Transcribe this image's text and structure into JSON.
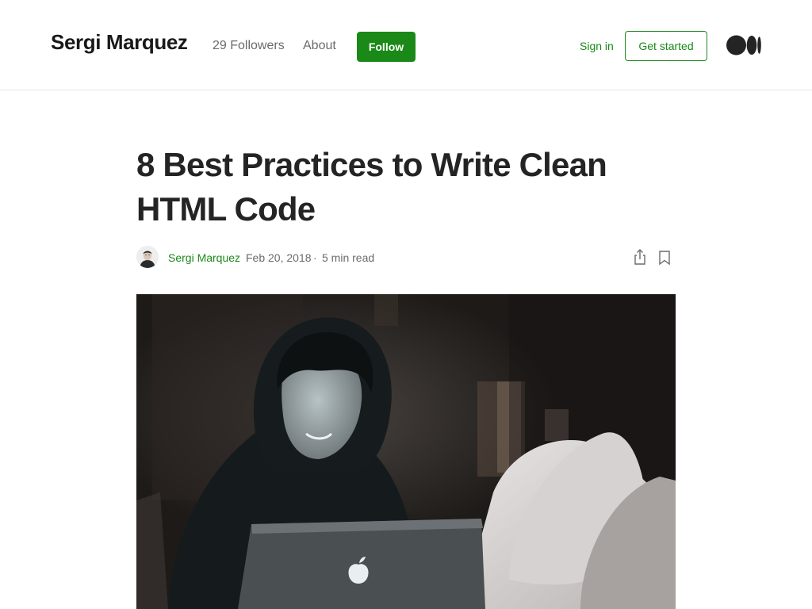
{
  "header": {
    "publication_name": "Sergi Marquez",
    "followers_label": "29 Followers",
    "about_label": "About",
    "follow_label": "Follow",
    "signin_label": "Sign in",
    "get_started_label": "Get started",
    "logo_icon": "medium-logo"
  },
  "article": {
    "title": "8 Best Practices to Write Clean HTML Code",
    "author": "Sergi Marquez",
    "date": "Feb 20, 2018",
    "separator": "·",
    "read_time": "5 min read",
    "hero_image_alt": "Person in a hoodie smiling at a laptop in a dark room"
  },
  "colors": {
    "accent_green": "#1a8917",
    "text_primary": "#242424",
    "text_secondary": "#6b6b6b",
    "divider": "#e6e6e6"
  },
  "icons": {
    "share": "share-icon",
    "bookmark": "bookmark-icon",
    "avatar": "author-avatar"
  }
}
